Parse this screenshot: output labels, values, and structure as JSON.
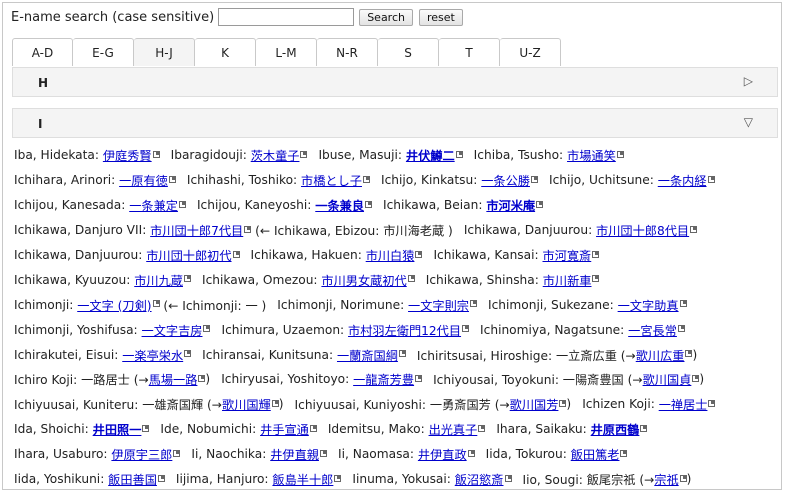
{
  "search": {
    "label": "E-name search (case sensitive)",
    "value": "",
    "search_label": "Search",
    "reset_label": "reset"
  },
  "tabs": [
    {
      "label": "A-D"
    },
    {
      "label": "E-G"
    },
    {
      "label": "H-J"
    },
    {
      "label": "K"
    },
    {
      "label": "L-M"
    },
    {
      "label": "N-R"
    },
    {
      "label": "S"
    },
    {
      "label": "T"
    },
    {
      "label": "U-Z"
    }
  ],
  "active_tab": "H-J",
  "sections": [
    {
      "title": "H",
      "arrow": "▷",
      "expanded": false
    },
    {
      "title": "I",
      "arrow": "▽",
      "expanded": true
    }
  ],
  "rows": [
    [
      {
        "pre": "Iba, Hidekata: ",
        "link": "伊庭秀賢"
      },
      {
        "pre": "Ibaragidouji: ",
        "link": "茨木童子"
      },
      {
        "pre": "Ibuse, Masuji: ",
        "link": "井伏鱒二",
        "bold": true
      },
      {
        "pre": "Ichiba, Tsusho: ",
        "link": "市場通笑"
      }
    ],
    [
      {
        "pre": "Ichihara, Arinori: ",
        "link": "一原有徳"
      },
      {
        "pre": "Ichihashi, Toshiko: ",
        "link": "市橋とし子"
      },
      {
        "pre": "Ichijo, Kinkatsu: ",
        "link": "一条公勝"
      },
      {
        "pre": "Ichijo, Uchitsune: ",
        "link": "一条内経"
      }
    ],
    [
      {
        "pre": "Ichijou, Kanesada: ",
        "link": "一条兼定"
      },
      {
        "pre": "Ichijou, Kaneyoshi: ",
        "link": "一条兼良",
        "bold": true
      },
      {
        "pre": "Ichikawa, Beian: ",
        "link": "市河米庵",
        "bold": true
      }
    ],
    [
      {
        "pre": "Ichikawa, Danjuro VII: ",
        "link": "市川団十郎7代目",
        "post": " (← Ichikawa, Ebizou: 市川海老蔵 )"
      },
      {
        "pre": "Ichikawa, Danjuurou: ",
        "link": "市川団十郎8代目"
      }
    ],
    [
      {
        "pre": "Ichikawa, Danjuurou: ",
        "link": "市川団十郎初代"
      },
      {
        "pre": "Ichikawa, Hakuen: ",
        "link": "市川白猿"
      },
      {
        "pre": "Ichikawa, Kansai: ",
        "link": "市河寛斎"
      }
    ],
    [
      {
        "pre": "Ichikawa, Kyuuzou: ",
        "link": "市川九蔵"
      },
      {
        "pre": "Ichikawa, Omezou: ",
        "link": "市川男女蔵初代"
      },
      {
        "pre": "Ichikawa, Shinsha: ",
        "link": "市川新車"
      }
    ],
    [
      {
        "pre": "Ichimonji: ",
        "link": "一文字 (刀剣)",
        "post": " (← Ichimonji: 一 )"
      },
      {
        "pre": "Ichimonji, Norimune: ",
        "link": "一文字則宗"
      },
      {
        "pre": "Ichimonji, Sukezane: ",
        "link": "一文字助真"
      }
    ],
    [
      {
        "pre": "Ichimonji, Yoshifusa: ",
        "link": "一文字吉房"
      },
      {
        "pre": "Ichimura, Uzaemon: ",
        "link": "市村羽左衛門12代目"
      },
      {
        "pre": "Ichinomiya, Nagatsune: ",
        "link": "一宮長常"
      }
    ],
    [
      {
        "pre": "Ichirakutei, Eisui: ",
        "link": "一楽亭栄水"
      },
      {
        "pre": "Ichiransai, Kunitsuna: ",
        "link": "一蘭斎国綱"
      },
      {
        "pre": "Ichiritsusai, Hiroshige: 一立斎広重 (→",
        "link": "歌川広重",
        "post": ")"
      }
    ],
    [
      {
        "pre": "Ichiro Koji: 一路居士 (→",
        "link": "馬場一路",
        "post": ")"
      },
      {
        "pre": "Ichiryusai, Yoshitoyo: ",
        "link": "一龍斎芳豊"
      },
      {
        "pre": "Ichiyousai, Toyokuni: 一陽斎豊国 (→",
        "link": "歌川国貞",
        "post": ")"
      }
    ],
    [
      {
        "pre": "Ichiyuusai, Kuniteru: 一雄斎国輝 (→",
        "link": "歌川国輝",
        "post": ")"
      },
      {
        "pre": "Ichiyuusai, Kuniyoshi: 一勇斎国芳 (→",
        "link": "歌川国芳",
        "post": ")"
      },
      {
        "pre": "Ichizen Koji: ",
        "link": "一禅居士"
      }
    ],
    [
      {
        "pre": "Ida, Shoichi: ",
        "link": "井田照一",
        "bold": true
      },
      {
        "pre": "Ide, Nobumichi: ",
        "link": "井手宣通"
      },
      {
        "pre": "Idemitsu, Mako: ",
        "link": "出光真子"
      },
      {
        "pre": "Ihara, Saikaku: ",
        "link": "井原西鶴",
        "bold": true
      }
    ],
    [
      {
        "pre": "Ihara, Usaburo: ",
        "link": "伊原宇三郎"
      },
      {
        "pre": "Ii, Naochika: ",
        "link": "井伊直親"
      },
      {
        "pre": "Ii, Naomasa: ",
        "link": "井伊直政"
      },
      {
        "pre": "Iida, Tokurou: ",
        "link": "飯田篤老"
      }
    ],
    [
      {
        "pre": "Iida, Yoshikuni: ",
        "link": "飯田善国"
      },
      {
        "pre": "Iijima, Hanjuro: ",
        "link": "飯島半十郎"
      },
      {
        "pre": "Iinuma, Yokusai: ",
        "link": "飯沼慾斎"
      },
      {
        "pre": "Iio, Sougi: 飯尾宗祇 (→",
        "link": "宗祇",
        "post": ")"
      }
    ]
  ]
}
